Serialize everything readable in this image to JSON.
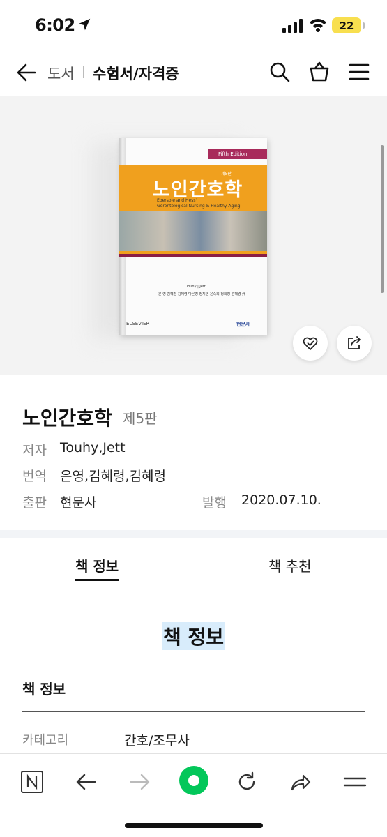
{
  "status_bar": {
    "time": "6:02",
    "battery": "22"
  },
  "nav": {
    "breadcrumb_parent": "도서",
    "breadcrumb_current": "수험서/자격증"
  },
  "book_cover": {
    "edition_banner": "Fifth Edition",
    "edition_mark": "제5판",
    "title": "노인간호학",
    "subtitle_line1": "Ebersole and Hess'",
    "subtitle_line2": "Gerontological Nursing & Healthy Aging",
    "authors": "Touhy | Jett",
    "translators": "은 영 김혜령 김혜령 박은영 정지연 윤숙희 정희영 엄혜경 外",
    "publisher_left": "ELSEVIER",
    "publisher_right": "현문사"
  },
  "product": {
    "title": "노인간호학",
    "edition": "제5판",
    "author_label": "저자",
    "author_value": "Touhy,Jett",
    "translator_label": "번역",
    "translator_value": "은영,김혜령,김혜령",
    "publisher_label": "출판",
    "publisher_value": "현문사",
    "date_label": "발행",
    "date_value": "2020.07.10."
  },
  "tabs": [
    {
      "label": "책 정보",
      "active": true
    },
    {
      "label": "책 추천",
      "active": false
    }
  ],
  "section": {
    "heading": "책 정보",
    "subheading": "책 정보",
    "rows": [
      {
        "label": "카테고리",
        "value": "간호/조무사"
      }
    ]
  },
  "icons": {
    "nav": [
      "back-arrow-icon",
      "search-icon",
      "shopping-bag-icon",
      "menu-icon"
    ],
    "fab": [
      "heart-check-icon",
      "share-icon"
    ],
    "toolbar": [
      "naver-n-icon",
      "back-icon",
      "forward-icon",
      "green-dot-icon",
      "refresh-icon",
      "share-arrow-icon",
      "more-menu-icon"
    ]
  },
  "colors": {
    "accent_green": "#03c75a",
    "cover_orange": "#f0a01e",
    "cover_magenta": "#a82b5b",
    "highlight": "#d8ecfb"
  }
}
